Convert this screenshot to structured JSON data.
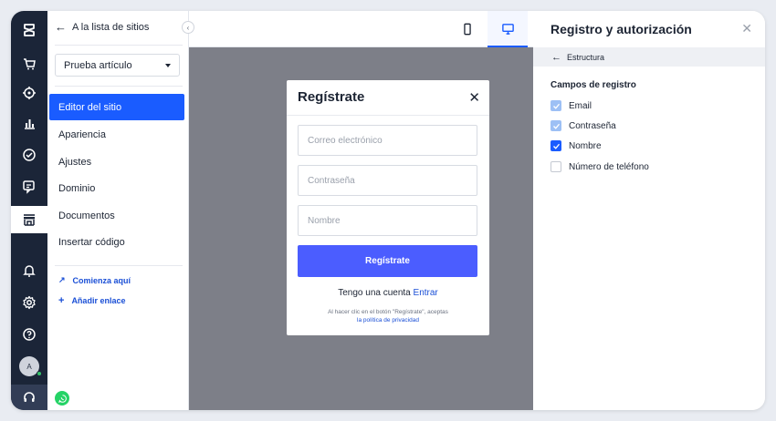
{
  "rail": {
    "items": [
      {
        "name": "logo-icon",
        "active": false
      },
      {
        "name": "store-cart-icon",
        "active": false
      },
      {
        "name": "target-icon",
        "active": false
      },
      {
        "name": "analytics-icon",
        "active": false
      },
      {
        "name": "check-circle-icon",
        "active": false
      },
      {
        "name": "chat-icon",
        "active": false
      },
      {
        "name": "storefront-icon",
        "active": true
      },
      {
        "name": "bell-icon",
        "active": false
      },
      {
        "name": "gear-icon",
        "active": false
      },
      {
        "name": "help-icon",
        "active": false
      }
    ],
    "avatar_initial": "A",
    "support_icon": "headset-icon"
  },
  "sidebar": {
    "back_label": "A la lista de sitios",
    "site_select_value": "Prueba artículo",
    "nav_items": [
      {
        "label": "Editor del sitio",
        "active": true
      },
      {
        "label": "Apariencia",
        "active": false
      },
      {
        "label": "Ajustes",
        "active": false
      },
      {
        "label": "Dominio",
        "active": false
      },
      {
        "label": "Documentos",
        "active": false
      },
      {
        "label": "Insertar código",
        "active": false
      }
    ],
    "get_started_label": "Comienza aquí",
    "add_link_label": "Añadir enlace"
  },
  "topbar": {
    "devices": [
      {
        "name": "mobile-icon",
        "active": false
      },
      {
        "name": "desktop-icon",
        "active": true
      }
    ]
  },
  "modal": {
    "title": "Regístrate",
    "fields": [
      {
        "placeholder": "Correo electrónico"
      },
      {
        "placeholder": "Contraseña"
      },
      {
        "placeholder": "Nombre"
      }
    ],
    "submit_label": "Regístrate",
    "account_text": "Tengo una cuenta",
    "login_link": "Entrar",
    "legal_text": "Al hacer clic en el botón \"Regístrate\", aceptas",
    "privacy_link": "la política de privacidad"
  },
  "panel": {
    "title": "Registro y autorización",
    "breadcrumb": "Estructura",
    "section_title": "Campos de registro",
    "fields": [
      {
        "label": "Email",
        "state": "checked-disabled"
      },
      {
        "label": "Contraseña",
        "state": "checked-disabled"
      },
      {
        "label": "Nombre",
        "state": "checked"
      },
      {
        "label": "Número de teléfono",
        "state": "unchecked"
      }
    ]
  },
  "colors": {
    "accent": "#1a5cff",
    "rail_bg": "#1b2538",
    "submit_bg": "#4b5dff",
    "canvas_bg": "#7d7f88"
  }
}
